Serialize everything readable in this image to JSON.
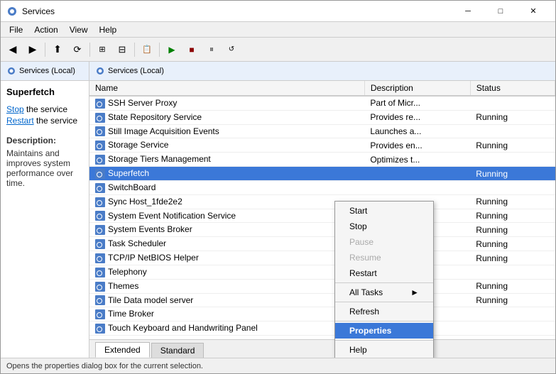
{
  "window": {
    "title": "Services",
    "controls": {
      "minimize": "─",
      "maximize": "□",
      "close": "✕"
    }
  },
  "menubar": {
    "items": [
      "File",
      "Action",
      "View",
      "Help"
    ]
  },
  "left_panel": {
    "header": "Services (Local)",
    "service_title": "Superfetch",
    "link_stop": "Stop",
    "stop_suffix": " the service",
    "link_restart": "Restart",
    "restart_suffix": " the service",
    "desc_label": "Description:",
    "desc_text": "Maintains and improves system performance over time."
  },
  "right_panel": {
    "header": "Services (Local)"
  },
  "table": {
    "columns": [
      "Name",
      "Description",
      "Status"
    ],
    "rows": [
      {
        "name": "SSH Server Proxy",
        "description": "Part of Micr...",
        "status": ""
      },
      {
        "name": "State Repository Service",
        "description": "Provides re...",
        "status": "Running"
      },
      {
        "name": "Still Image Acquisition Events",
        "description": "Launches a...",
        "status": ""
      },
      {
        "name": "Storage Service",
        "description": "Provides en...",
        "status": "Running"
      },
      {
        "name": "Storage Tiers Management",
        "description": "Optimizes t...",
        "status": ""
      },
      {
        "name": "Superfetch",
        "description": "",
        "status": "Running"
      },
      {
        "name": "SwitchBoard",
        "description": "",
        "status": ""
      },
      {
        "name": "Sync Host_1fde2e2",
        "description": "",
        "status": "Running"
      },
      {
        "name": "System Event Notification Service",
        "description": "",
        "status": "Running"
      },
      {
        "name": "System Events Broker",
        "description": "",
        "status": "Running"
      },
      {
        "name": "Task Scheduler",
        "description": "",
        "status": "Running"
      },
      {
        "name": "TCP/IP NetBIOS Helper",
        "description": "",
        "status": "Running"
      },
      {
        "name": "Telephony",
        "description": "",
        "status": ""
      },
      {
        "name": "Themes",
        "description": "",
        "status": "Running"
      },
      {
        "name": "Tile Data model server",
        "description": "",
        "status": "Running"
      },
      {
        "name": "Time Broker",
        "description": "",
        "status": ""
      },
      {
        "name": "Touch Keyboard and Handwriting Panel",
        "description": "",
        "status": ""
      }
    ]
  },
  "context_menu": {
    "items": [
      {
        "label": "Start",
        "disabled": false
      },
      {
        "label": "Stop",
        "disabled": false
      },
      {
        "label": "Pause",
        "disabled": true
      },
      {
        "label": "Resume",
        "disabled": true
      },
      {
        "label": "Restart",
        "disabled": false
      },
      {
        "separator": true
      },
      {
        "label": "All Tasks",
        "arrow": true,
        "disabled": false
      },
      {
        "separator": true
      },
      {
        "label": "Refresh",
        "disabled": false
      },
      {
        "separator": true
      },
      {
        "label": "Properties",
        "highlighted": true
      },
      {
        "separator": true
      },
      {
        "label": "Help",
        "disabled": false
      }
    ]
  },
  "tabs": {
    "items": [
      "Extended",
      "Standard"
    ],
    "active": "Extended"
  },
  "status_bar": {
    "text": "Opens the properties dialog box for the current selection."
  }
}
